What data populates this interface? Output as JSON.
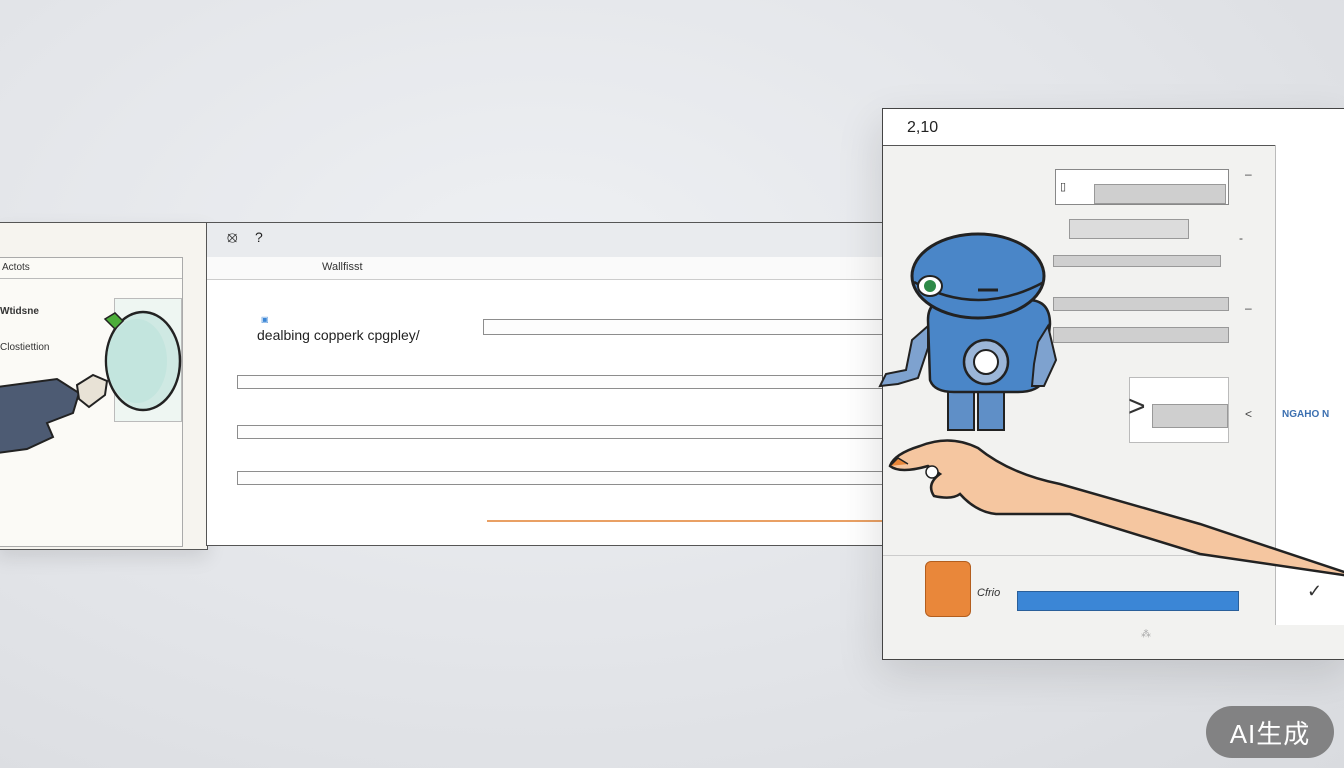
{
  "left_window": {
    "header": "Actots",
    "label_1": "Wtidsne",
    "label_2": "Clostiettion"
  },
  "mid_window": {
    "tab_label": "Wallfisst",
    "heading": "dealbing copperk cpgpley/"
  },
  "right_window": {
    "title": "2,10",
    "side_label": "NGAHO N",
    "bottom_label": "Cfrio"
  },
  "watermark": "AI生成",
  "colors": {
    "accent_blue": "#3b86d6",
    "robot_blue": "#4a86c8",
    "orange": "#e9873a",
    "skin": "#f5c6a0"
  }
}
